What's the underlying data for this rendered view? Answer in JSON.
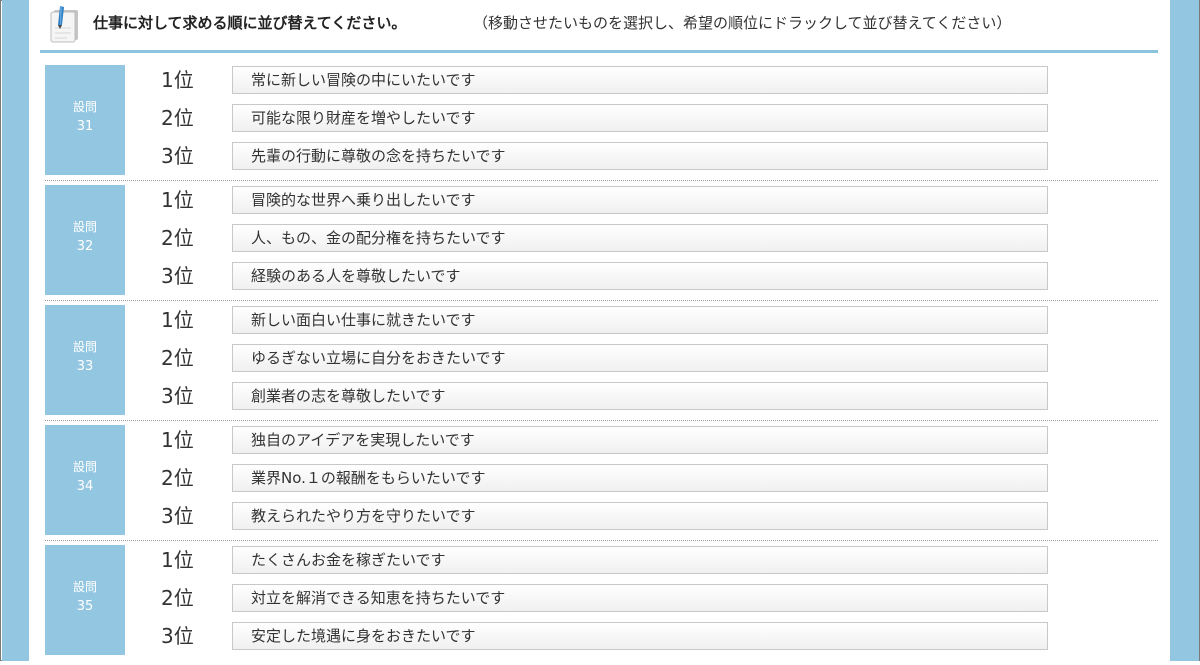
{
  "header": {
    "title": "仕事に対して求める順に並び替えてください。",
    "subtitle": "（移動させたいものを選択し、希望の順位にドラックして並び替えてください）"
  },
  "questions": [
    {
      "label": "設問",
      "number": "31",
      "ranks": [
        "1位",
        "2位",
        "3位"
      ],
      "items": [
        "常に新しい冒険の中にいたいです",
        "可能な限り財産を増やしたいです",
        "先輩の行動に尊敬の念を持ちたいです"
      ]
    },
    {
      "label": "設問",
      "number": "32",
      "ranks": [
        "1位",
        "2位",
        "3位"
      ],
      "items": [
        "冒険的な世界へ乗り出したいです",
        "人、もの、金の配分権を持ちたいです",
        "経験のある人を尊敬したいです"
      ]
    },
    {
      "label": "設問",
      "number": "33",
      "ranks": [
        "1位",
        "2位",
        "3位"
      ],
      "items": [
        "新しい面白い仕事に就きたいです",
        "ゆるぎない立場に自分をおきたいです",
        "創業者の志を尊敬したいです"
      ]
    },
    {
      "label": "設問",
      "number": "34",
      "ranks": [
        "1位",
        "2位",
        "3位"
      ],
      "items": [
        "独自のアイデアを実現したいです",
        "業界No.１の報酬をもらいたいです",
        "教えられたやり方を守りたいです"
      ]
    },
    {
      "label": "設問",
      "number": "35",
      "ranks": [
        "1位",
        "2位",
        "3位"
      ],
      "items": [
        "たくさんお金を稼ぎたいです",
        "対立を解消できる知恵を持ちたいです",
        "安定した境遇に身をおきたいです"
      ]
    }
  ],
  "colors": {
    "accent": "#93c6e0",
    "item_border": "#c8c8c8"
  },
  "icons": {
    "header_icon": "notepad-pencil-icon"
  }
}
